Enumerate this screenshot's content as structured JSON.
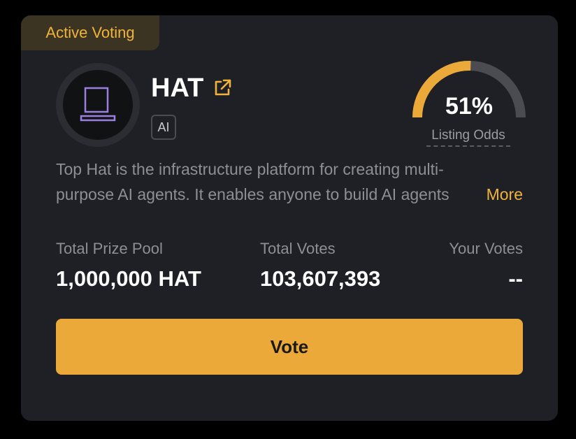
{
  "status_tag": "Active Voting",
  "token": {
    "name": "HAT",
    "category": "AI",
    "logo_icon": "laptop-icon",
    "link_icon": "external-link-icon"
  },
  "listing_odds": {
    "value": "51%",
    "fraction": 0.51,
    "label": "Listing Odds"
  },
  "description": {
    "line1": "Top Hat is the infrastructure platform for creating multi-",
    "line2": "purpose AI agents. It enables anyone to build AI agents",
    "more_label": "More"
  },
  "stats": {
    "prize_pool_label": "Total Prize Pool",
    "prize_pool_value": "1,000,000 HAT",
    "total_votes_label": "Total Votes",
    "total_votes_value": "103,607,393",
    "your_votes_label": "Your Votes",
    "your_votes_value": "--"
  },
  "vote_button_label": "Vote",
  "colors": {
    "accent": "#eba93a",
    "card_bg": "#1e2026",
    "text_muted": "#8d8f94",
    "logo_purple": "#9b7fe0"
  }
}
